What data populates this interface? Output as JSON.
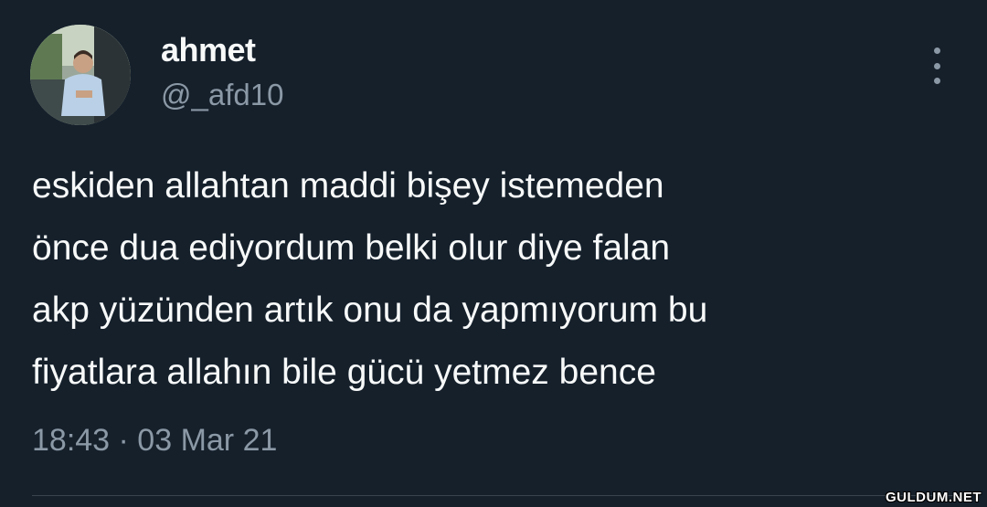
{
  "user": {
    "display_name": "ahmet",
    "handle": "@_afd10"
  },
  "tweet": {
    "text_lines": [
      "eskiden allahtan maddi bişey istemeden",
      "önce dua ediyordum belki olur diye falan",
      "akp yüzünden artık onu da yapmıyorum bu",
      "fiyatlara allahın bile gücü yetmez bence"
    ],
    "timestamp": "18:43 · 03 Mar 21"
  },
  "icons": {
    "more": "more-vertical-icon",
    "avatar": "profile-photo"
  },
  "watermark": "GULDUM.NET",
  "colors": {
    "background": "#15202b",
    "primary_text": "#f7f9f9",
    "secondary_text": "#8b98a5",
    "divider": "#38444d"
  }
}
